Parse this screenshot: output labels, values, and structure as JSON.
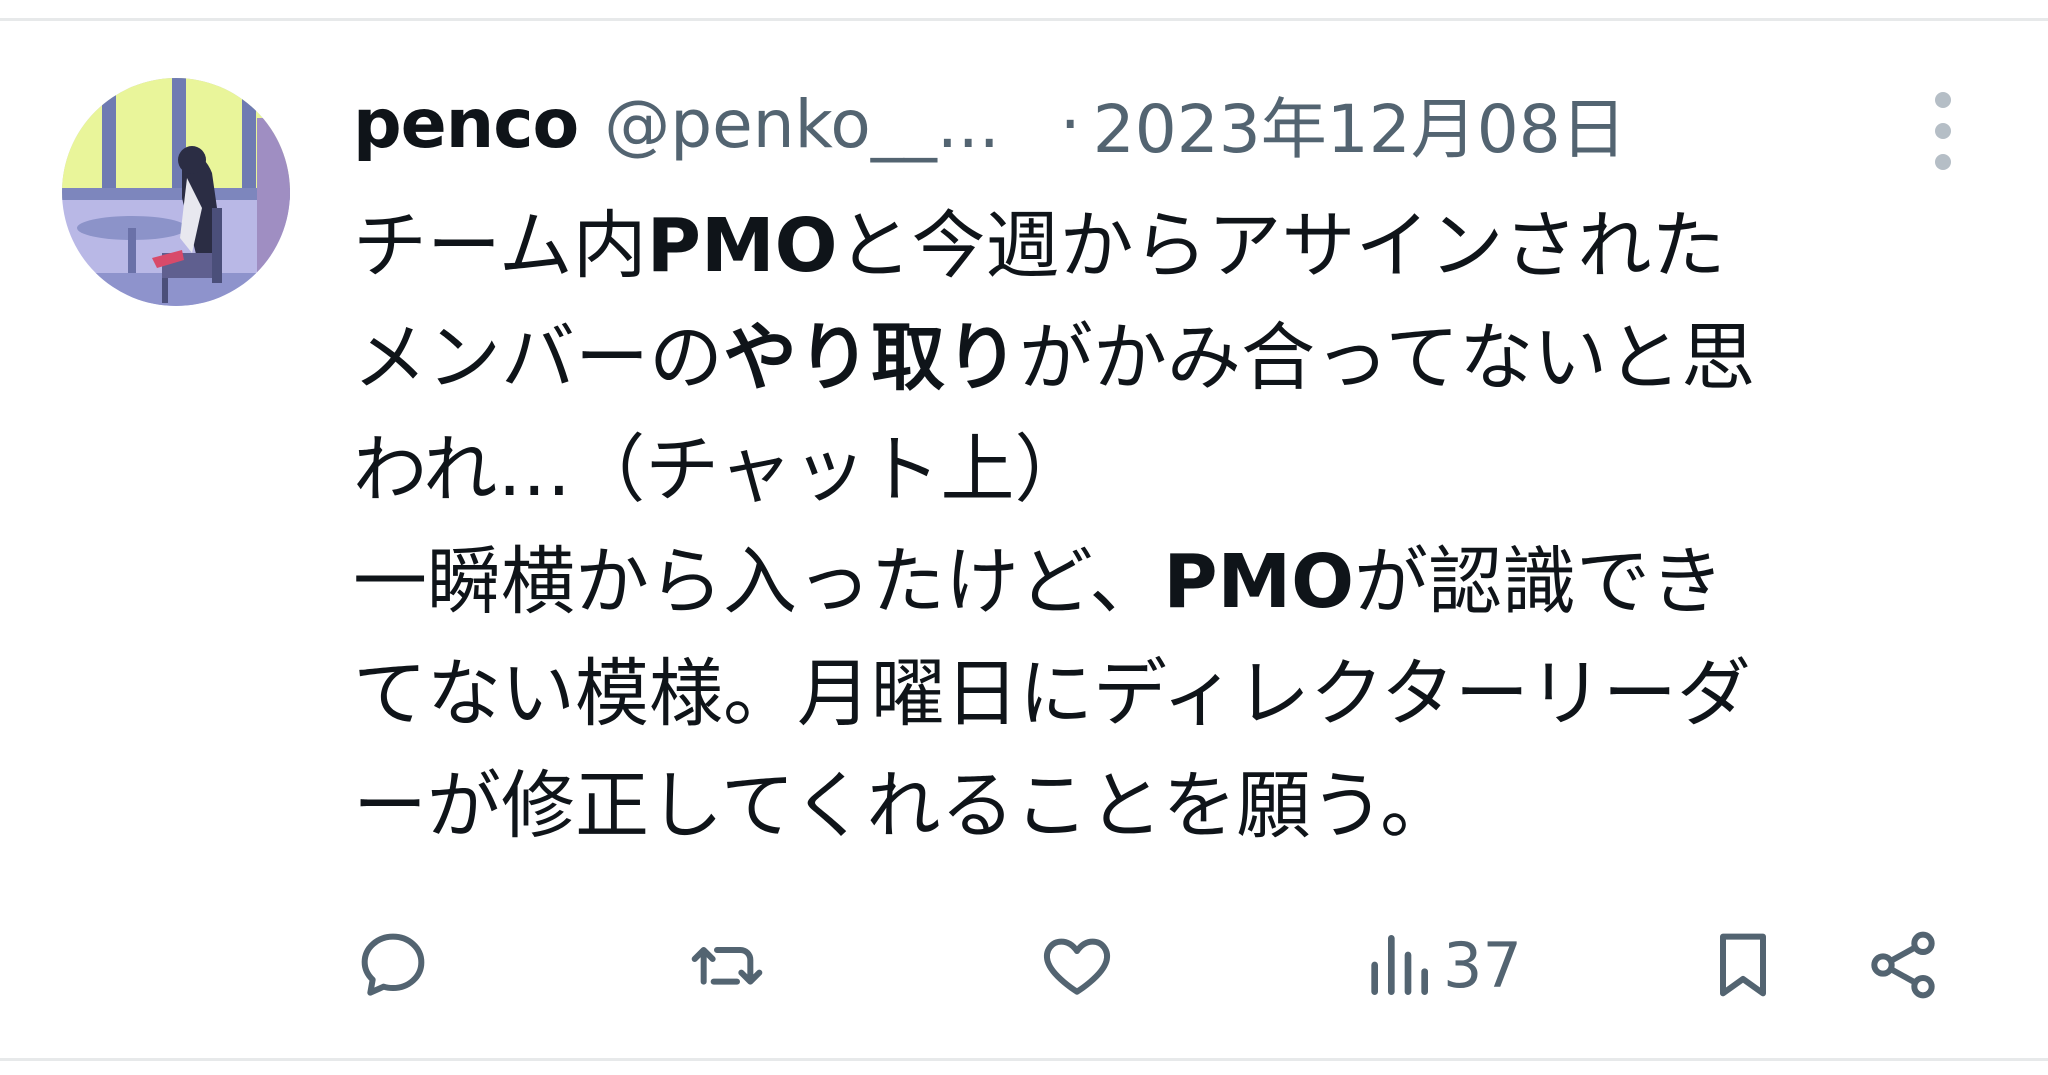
{
  "author": {
    "display_name": "penco",
    "handle": "@penko__...",
    "avatar_icon": "avatar-illustration-icon"
  },
  "meta": {
    "separator": "·",
    "timestamp": "2023年12月08日"
  },
  "tweet": {
    "lines": [
      [
        "チーム内",
        "PMO",
        "と今週からアサインされた"
      ],
      [
        "メンバーの",
        "やり取り",
        "がかみ合ってないと思"
      ],
      [
        "われ…（チャット上）"
      ],
      [
        "一瞬横から入ったけど、",
        "PMO",
        "が認識でき"
      ],
      [
        "てない模様。月曜日にディレクターリーダ"
      ],
      [
        "ーが修正してくれることを願う。"
      ]
    ]
  },
  "actions": {
    "reply_icon": "reply-icon",
    "retweet_icon": "retweet-icon",
    "like_icon": "heart-icon",
    "views_icon": "views-chart-icon",
    "views_count": "37",
    "bookmark_icon": "bookmark-icon",
    "share_icon": "share-icon"
  },
  "colors": {
    "text_primary": "#0f1419",
    "text_secondary": "#536471",
    "divider": "#e7e9ea"
  }
}
